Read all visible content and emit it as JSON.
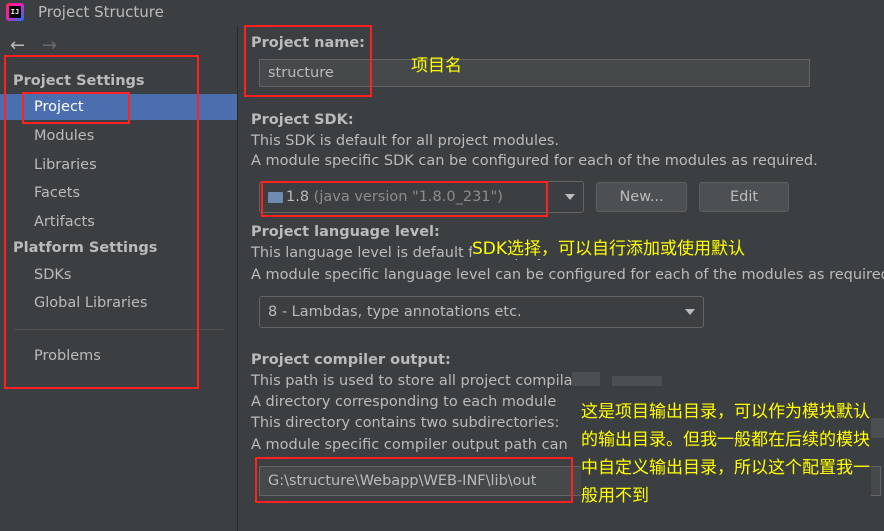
{
  "window": {
    "title": "Project Structure",
    "app_icon_label": "IJ"
  },
  "nav": {
    "back": "←",
    "forward": "→"
  },
  "sidebar": {
    "project_settings_header": "Project Settings",
    "project_settings": [
      "Project",
      "Modules",
      "Libraries",
      "Facets",
      "Artifacts"
    ],
    "platform_settings_header": "Platform Settings",
    "platform_settings": [
      "SDKs",
      "Global Libraries"
    ],
    "problems": "Problems"
  },
  "project": {
    "name_label": "Project name:",
    "name_value": "structure",
    "sdk_label": "Project SDK:",
    "sdk_desc1": "This SDK is default for all project modules.",
    "sdk_desc2": "A module specific SDK can be configured for each of the modules as required.",
    "sdk_value": "1.8",
    "sdk_version": "(java version \"1.8.0_231\")",
    "new_button": "New...",
    "edit_button": "Edit",
    "lang_label": "Project language level:",
    "lang_desc1": "This language level is default for all project modules.",
    "lang_desc2": "A module specific language level can be configured for each of the modules as required.",
    "lang_value": "8 - Lambdas, type annotations etc.",
    "compiler_label": "Project compiler output:",
    "compiler_desc1": "This path is used to store all project compila",
    "compiler_desc2": "A directory corresponding to each module",
    "compiler_desc3": "This directory contains two subdirectories:",
    "compiler_desc4": "A module specific compiler output path can",
    "compiler_value": "G:\\structure\\Webapp\\WEB-INF\\lib\\out"
  },
  "annotations": {
    "note1": "项目名",
    "note2": "SDK选择，可以自行添加或使用默认",
    "note3": "这是项目输出目录，可以作为模块默认的输出目录。但我一般都在后续的模块中自定义输出目录，所以这个配置我一般用不到"
  },
  "colors": {
    "selection": "#4b6eaf",
    "annotation_box": "#ff2020",
    "annotation_text": "#ffff00"
  }
}
